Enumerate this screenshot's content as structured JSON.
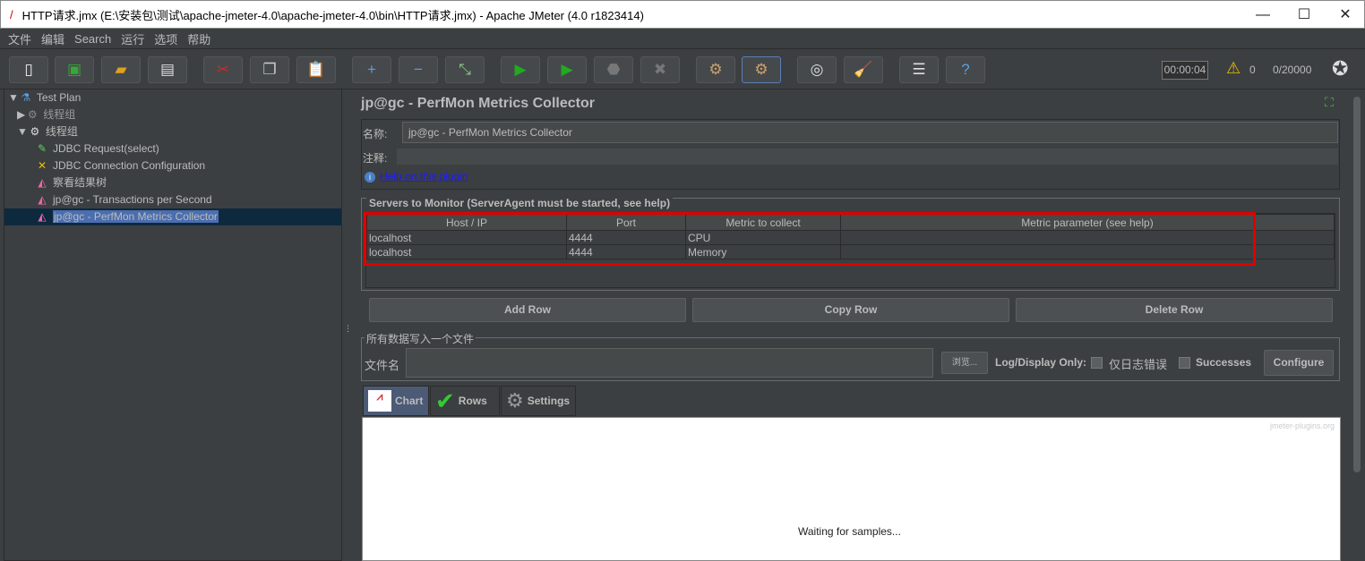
{
  "window": {
    "title": "HTTP请求.jmx (E:\\安装包\\测试\\apache-jmeter-4.0\\apache-jmeter-4.0\\bin\\HTTP请求.jmx) - Apache JMeter (4.0 r1823414)",
    "minimize": "—",
    "maximize": "☐",
    "close": "✕"
  },
  "menu": [
    "文件",
    "编辑",
    "Search",
    "运行",
    "选项",
    "帮助"
  ],
  "status": {
    "timer": "00:00:04",
    "warnings": "0",
    "threads": "0/20000"
  },
  "tree": {
    "items": [
      {
        "label": "Test Plan"
      },
      {
        "label": "线程组"
      },
      {
        "label": "线程组"
      },
      {
        "label": "JDBC Request(select)"
      },
      {
        "label": "JDBC Connection Configuration"
      },
      {
        "label": "察看结果树"
      },
      {
        "label": "jp@gc - Transactions per Second"
      },
      {
        "label": "jp@gc - PerfMon Metrics Collector"
      }
    ]
  },
  "panel": {
    "title": "jp@gc - PerfMon Metrics Collector",
    "name_label": "名称:",
    "name_value": "jp@gc - PerfMon Metrics Collector",
    "comment_label": "注释:",
    "comment_value": "",
    "help_link": "Help on this plugin"
  },
  "servers": {
    "legend": "Servers to Monitor (ServerAgent must be started, see help)",
    "columns": [
      "Host / IP",
      "Port",
      "Metric to collect",
      "Metric parameter (see help)"
    ],
    "rows": [
      [
        "localhost",
        "4444",
        "CPU",
        ""
      ],
      [
        "localhost",
        "4444",
        "Memory",
        ""
      ]
    ],
    "add": "Add Row",
    "copy": "Copy Row",
    "delete": "Delete Row"
  },
  "file": {
    "legend": "所有数据写入一个文件",
    "filename_label": "文件名",
    "filename_value": "",
    "browse": "浏览...",
    "log_label": "Log/Display Only:",
    "errors_label": "仅日志错误",
    "errors_checked": false,
    "successes_label": "Successes",
    "successes_checked": false,
    "configure": "Configure"
  },
  "tabs": [
    {
      "label": "Chart"
    },
    {
      "label": "Rows"
    },
    {
      "label": "Settings"
    }
  ],
  "chart": {
    "watermark": "jmeter-plugins.org",
    "message": "Waiting for samples..."
  }
}
